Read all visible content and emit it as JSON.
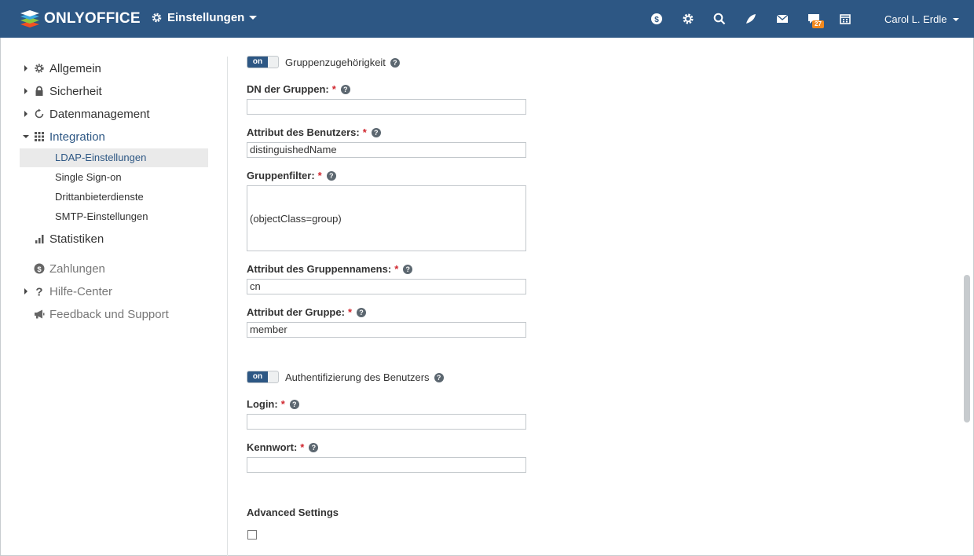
{
  "header": {
    "logo_text": "ONLYOFFICE",
    "module": "Einstellungen",
    "icons": [
      "payment-icon",
      "settings-icon",
      "search-icon",
      "feed-icon",
      "mail-icon",
      "chat-icon",
      "calendar-icon"
    ],
    "chat_badge": "27",
    "user_name": "Carol L. Erdle"
  },
  "sidebar": {
    "items": [
      {
        "label": "Allgemein",
        "icon": "gear-icon",
        "expandable": true
      },
      {
        "label": "Sicherheit",
        "icon": "lock-icon",
        "expandable": true
      },
      {
        "label": "Datenmanagement",
        "icon": "refresh-icon",
        "expandable": true
      },
      {
        "label": "Integration",
        "icon": "grid-icon",
        "expanded": true
      },
      {
        "label": "Statistiken",
        "icon": "bar-chart-icon"
      },
      {
        "label": "Zahlungen",
        "icon": "dollar-icon"
      },
      {
        "label": "Hilfe-Center",
        "icon": "question-icon",
        "expandable": true
      },
      {
        "label": "Feedback und Support",
        "icon": "megaphone-icon"
      }
    ],
    "integration_sub": [
      {
        "label": "LDAP-Einstellungen",
        "selected": true
      },
      {
        "label": "Single Sign-on"
      },
      {
        "label": "Drittanbieterdienste"
      },
      {
        "label": "SMTP-Einstellungen"
      }
    ]
  },
  "form": {
    "toggle_on_label": "on",
    "group_membership_label": "Gruppenzugehörigkeit",
    "group_dn_label": "DN der Gruppen:",
    "group_dn_value": "",
    "user_attribute_label": "Attribut des Benutzers:",
    "user_attribute_value": "distinguishedName",
    "group_filter_label": "Gruppenfilter:",
    "group_filter_value": "(objectClass=group)",
    "group_name_attribute_label": "Attribut des Gruppennamens:",
    "group_name_attribute_value": "cn",
    "group_attribute_label": "Attribut der Gruppe:",
    "group_attribute_value": "member",
    "user_auth_label": "Authentifizierung des Benutzers",
    "login_label": "Login:",
    "login_value": "",
    "password_label": "Kennwort:",
    "password_value": "",
    "advanced_settings_label": "Advanced Settings",
    "required_marker": "*",
    "help_glyph": "?"
  },
  "colors": {
    "header_bg": "#2d5784",
    "accent": "#2d5784",
    "required": "#d0272f",
    "badge": "#f2891d"
  }
}
